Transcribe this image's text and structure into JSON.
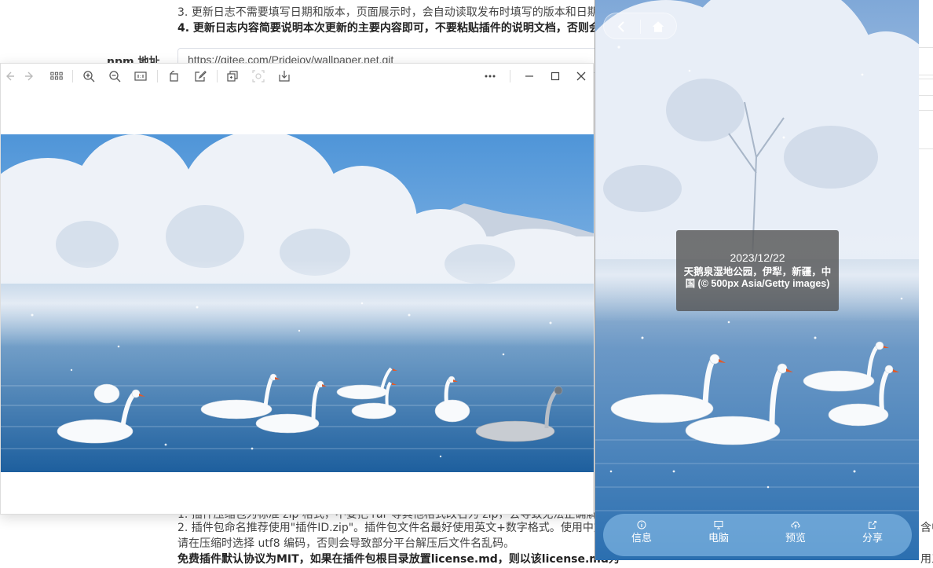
{
  "background_page": {
    "lines": [
      "3. 更新日志不需要填写日期和版本，页面展示时，会自动读取发布时填写的版本和日期",
      "4. 更新日志内容简要说明本次更新的主要内容即可，不要粘贴插件的说明文档，否则会",
      "1. 插件压缩包为标准 zip 格式，不要把 rar 等其他格式改名为 zip，会导致无法正确解压",
      "2. 插件包命名推荐使用\"插件ID.zip\"。插件包文件名最好使用英文+数字格式。使用中文",
      "请在压缩时选择 utf8 编码，否则会导致部分平台解压后文件名乱码。",
      "免费插件默认协议为MIT，如果在插件包根目录放置license.md，则以该license.md为"
    ],
    "npm_label": "npm 地址",
    "repo_url": "https://gitee.com/Pridejoy/wallpaper.net.git",
    "right_fragments": [
      "含中",
      "用三"
    ]
  },
  "viewer": {
    "toolbar_icons": [
      "arrow-left-icon",
      "arrow-right-icon",
      "grid-icon",
      "zoom-in-icon",
      "zoom-out-icon",
      "actual-size-icon",
      "rotate-icon",
      "edit-icon",
      "copy-icon",
      "ocr-icon",
      "download-icon",
      "more-icon",
      "minimize-icon",
      "maximize-icon",
      "close-icon"
    ]
  },
  "phone": {
    "date": "2023/12/22",
    "description": "天鹅泉湿地公园，伊犁，新疆，中国 (© 500px Asia/Getty images)",
    "tabs": [
      {
        "label": "信息",
        "icon": "info-icon"
      },
      {
        "label": "电脑",
        "icon": "monitor-icon"
      },
      {
        "label": "预览",
        "icon": "cloud-icon"
      },
      {
        "label": "分享",
        "icon": "share-icon"
      }
    ]
  },
  "colors": {
    "tabbar": "#96c8f0",
    "info_box": "#505050",
    "accent_sky": "#2e82c8"
  }
}
